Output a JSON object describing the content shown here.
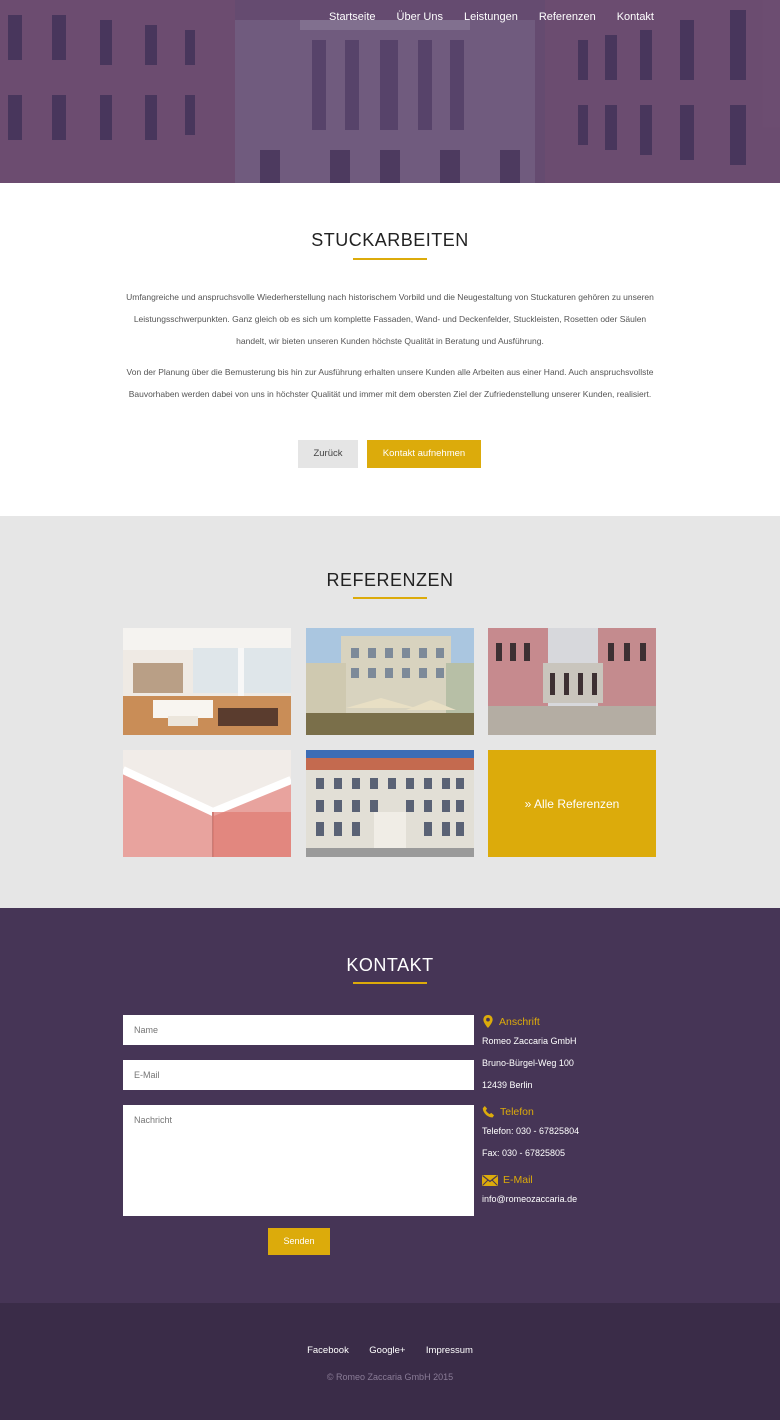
{
  "nav": {
    "items": [
      "Startseite",
      "Über Uns",
      "Leistungen",
      "Referenzen",
      "Kontakt"
    ]
  },
  "stuck": {
    "title": "STUCKARBEITEN",
    "paragraph1": "Umfangreiche und anspruchsvolle Wiederherstellung nach historischem Vorbild und die Neugestaltung von Stuckaturen gehören zu unseren Leistungsschwerpunkten. Ganz gleich ob es sich um komplette Fassaden, Wand- und Deckenfelder, Stuckleisten, Rosetten oder Säulen handelt, wir bieten unseren Kunden höchste Qualität in Beratung und Ausführung.",
    "paragraph2": "Von der Planung über die Bemusterung bis hin zur Ausführung erhalten unsere Kunden alle Arbeiten aus einer Hand. Auch anspruchsvollste Bauvorhaben werden dabei von uns in höchster Qualität und immer mit dem obersten Ziel der Zufriedenstellung unserer Kunden, realisiert.",
    "back_label": "Zurück",
    "contact_label": "Kontakt aufnehmen"
  },
  "referenzen": {
    "title": "REFERENZEN",
    "all_label": "» Alle Referenzen"
  },
  "kontakt": {
    "title": "KONTAKT",
    "name_placeholder": "Name",
    "email_placeholder": "E-Mail",
    "message_placeholder": "Nachricht",
    "send_label": "Senden",
    "address_head": "Anschrift",
    "address_lines": [
      "Romeo Zaccaria GmbH",
      "Bruno-Bürgel-Weg 100",
      "12439 Berlin"
    ],
    "phone_head": "Telefon",
    "phone_lines": [
      "Telefon: 030 - 67825804",
      "Fax: 030 - 67825805"
    ],
    "mail_head": "E-Mail",
    "mail_line": "info@romeozaccaria.de"
  },
  "footer": {
    "links": [
      "Facebook",
      "Google+",
      "Impressum"
    ],
    "copyright": "© Romeo Zaccaria GmbH 2015"
  },
  "colors": {
    "accent": "#dcab0b",
    "purple": "#463556",
    "footer": "#3a2c48",
    "grey": "#e6e6e6"
  },
  "icons": {
    "address": "map-pin-icon",
    "phone": "phone-icon",
    "mail": "envelope-icon"
  }
}
